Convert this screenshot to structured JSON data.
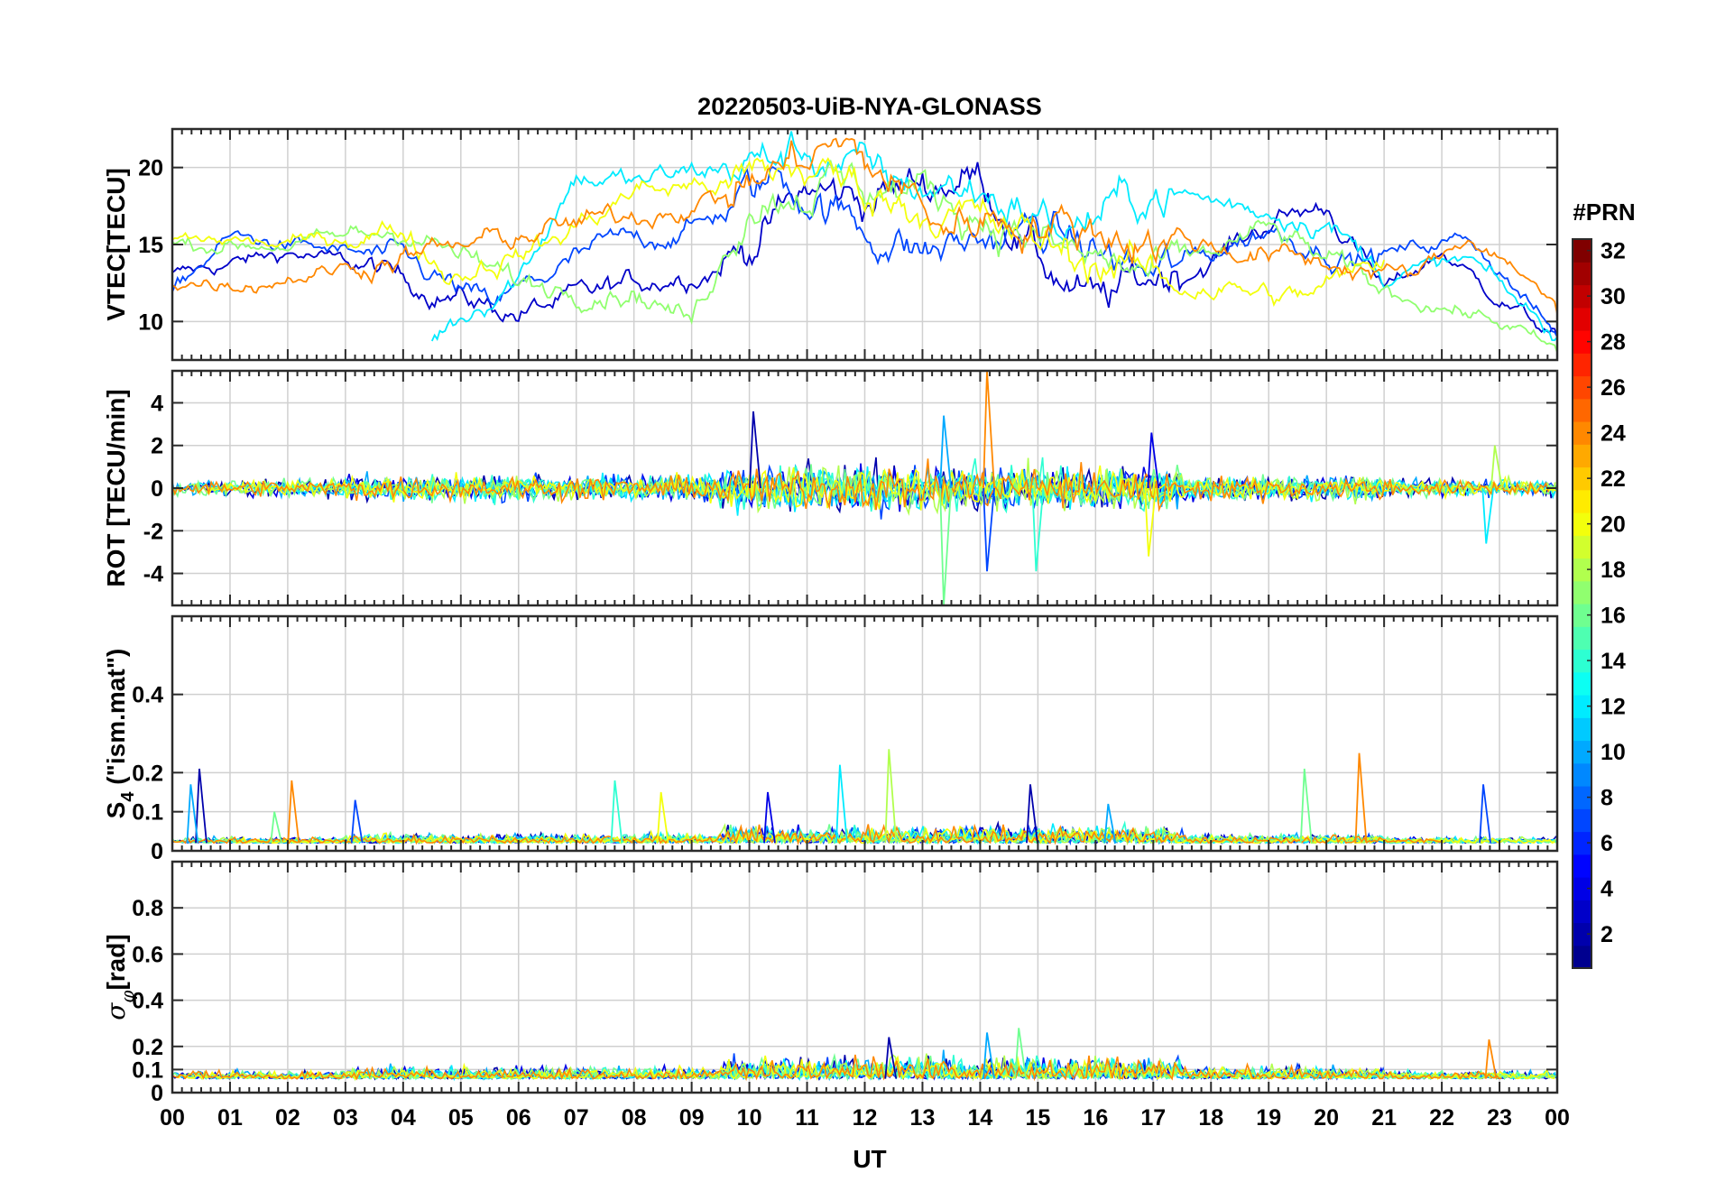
{
  "title": "20220503-UiB-NYA-GLONASS",
  "xlabel": "UT",
  "x_tick_labels": [
    "00",
    "01",
    "02",
    "03",
    "04",
    "05",
    "06",
    "07",
    "08",
    "09",
    "10",
    "11",
    "12",
    "13",
    "14",
    "15",
    "16",
    "17",
    "18",
    "19",
    "20",
    "21",
    "22",
    "23",
    "00"
  ],
  "colorbar": {
    "label": "#PRN",
    "ticks": [
      "2",
      "4",
      "6",
      "8",
      "10",
      "12",
      "14",
      "16",
      "18",
      "20",
      "22",
      "24",
      "26",
      "28",
      "30",
      "32"
    ],
    "range": [
      1,
      32
    ],
    "colormap": "jet",
    "colors": [
      "#00008f",
      "#0000ff",
      "#0080ff",
      "#00ffff",
      "#80ff80",
      "#ffff00",
      "#ff8000",
      "#ff0000",
      "#800000"
    ]
  },
  "chart_data": [
    {
      "type": "line",
      "panel": "VTEC",
      "ylabel": "VTEC[TECU]",
      "xlim": [
        0,
        24
      ],
      "ylim": [
        7.5,
        22.5
      ],
      "y_ticks": [
        "10",
        "15",
        "20"
      ],
      "grid": true,
      "series_profiles": [
        {
          "prn": 3,
          "x": [
            0.0,
            2.0,
            3.5,
            4.5,
            6.0,
            8.0,
            9.5,
            10.0,
            11.0,
            12.0,
            13.0,
            14.0,
            15.0,
            16.0,
            17.0,
            18.0,
            19.0,
            20.0,
            21.0,
            22.0,
            23.0,
            24.0
          ],
          "y": [
            13,
            14.5,
            13.5,
            12,
            10.5,
            12.5,
            13.5,
            15,
            18.5,
            18,
            19,
            19.5,
            14,
            11,
            13,
            14,
            16.5,
            17.5,
            12,
            14.5,
            11.5,
            9
          ]
        },
        {
          "prn": 7,
          "x": [
            0.0,
            1.0,
            2.0,
            4.0,
            5.5,
            7.5,
            9.0,
            10.5,
            12.0,
            13.0,
            15.0,
            17.0,
            19.0,
            20.5,
            22.5,
            24.0
          ],
          "y": [
            12,
            15.5,
            15,
            14,
            11,
            15,
            16,
            19.5,
            16,
            14.5,
            16,
            13,
            16,
            14,
            15.5,
            9
          ]
        },
        {
          "prn": 12,
          "x": [
            4.5,
            6.0,
            7.0,
            8.0,
            9.5,
            11.0,
            12.5,
            14.0,
            15.5,
            17.0,
            18.5,
            20.0,
            21.0,
            22.5,
            24.0
          ],
          "y": [
            9,
            13,
            19.5,
            19,
            20,
            21,
            19,
            18.5,
            16,
            18.5,
            17.5,
            16.5,
            13,
            14,
            9
          ]
        },
        {
          "prn": 17,
          "x": [
            0.0,
            2.0,
            4.0,
            6.0,
            8.0,
            9.0,
            10.0,
            11.5,
            13.0,
            14.0,
            15.5,
            17.0,
            19.0,
            21.0,
            23.0,
            24.0
          ],
          "y": [
            15,
            15,
            16,
            12.5,
            12,
            10,
            18,
            19,
            18.5,
            17,
            14.5,
            13,
            16,
            12,
            10,
            8
          ]
        },
        {
          "prn": 20,
          "x": [
            0.0,
            2.0,
            4.0,
            4.8,
            6.5,
            8.0,
            9.5,
            11.0,
            12.5,
            14.0,
            15.5,
            17.5,
            19.5,
            21.0
          ],
          "y": [
            15.5,
            15,
            16,
            13,
            15,
            18.5,
            19,
            20,
            18,
            16.5,
            14.5,
            12.5,
            11.5,
            14
          ]
        },
        {
          "prn": 24,
          "x": [
            0.0,
            1.5,
            9.5,
            10.5,
            11.5,
            12.5,
            13.5,
            14.0,
            21.5,
            22.5,
            23.5,
            24.0
          ],
          "y": [
            12.5,
            12.5,
            18,
            20,
            21.5,
            19,
            16,
            17,
            13,
            15.5,
            13,
            10.5
          ]
        }
      ]
    },
    {
      "type": "line",
      "panel": "ROT",
      "ylabel": "ROT [TECU/min]",
      "xlim": [
        0,
        24
      ],
      "ylim": [
        -5.5,
        5.5
      ],
      "y_ticks": [
        "4",
        "2",
        "0",
        "-2",
        "-4"
      ],
      "grid": true,
      "notable_spikes": [
        {
          "x": 10.1,
          "y": 3.6
        },
        {
          "x": 13.4,
          "y": 3.4
        },
        {
          "x": 13.4,
          "y": -5.5
        },
        {
          "x": 14.15,
          "y": 5.5
        },
        {
          "x": 14.15,
          "y": -3.9
        },
        {
          "x": 15.0,
          "y": -3.9
        },
        {
          "x": 16.95,
          "y": -3.2
        },
        {
          "x": 17.0,
          "y": 2.6
        },
        {
          "x": 22.8,
          "y": -2.6
        },
        {
          "x": 22.95,
          "y": 2.0
        }
      ]
    },
    {
      "type": "line",
      "panel": "S4",
      "ylabel": "S4 (\"ism.mat\")",
      "xlim": [
        0,
        24
      ],
      "ylim": [
        0,
        0.6
      ],
      "y_ticks": [
        "0",
        "0.1",
        "0.2",
        "0.4"
      ],
      "grid": true,
      "notable_spikes": [
        {
          "x": 0.5,
          "y": 0.21
        },
        {
          "x": 0.35,
          "y": 0.17
        },
        {
          "x": 1.8,
          "y": 0.1
        },
        {
          "x": 2.1,
          "y": 0.18
        },
        {
          "x": 3.2,
          "y": 0.13
        },
        {
          "x": 7.7,
          "y": 0.18
        },
        {
          "x": 8.5,
          "y": 0.15
        },
        {
          "x": 10.35,
          "y": 0.15
        },
        {
          "x": 11.6,
          "y": 0.22
        },
        {
          "x": 12.45,
          "y": 0.26
        },
        {
          "x": 14.9,
          "y": 0.17
        },
        {
          "x": 16.25,
          "y": 0.12
        },
        {
          "x": 19.65,
          "y": 0.21
        },
        {
          "x": 20.6,
          "y": 0.25
        },
        {
          "x": 22.75,
          "y": 0.17
        }
      ]
    },
    {
      "type": "line",
      "panel": "SigmaPhi",
      "ylabel": "σφ[rad]",
      "xlim": [
        0,
        24
      ],
      "ylim": [
        0,
        1.0
      ],
      "y_ticks": [
        "0",
        "0.1",
        "0.2",
        "0.4",
        "0.6",
        "0.8"
      ],
      "grid": true,
      "notable_spikes": [
        {
          "x": 12.45,
          "y": 0.24
        },
        {
          "x": 14.15,
          "y": 0.26
        },
        {
          "x": 14.7,
          "y": 0.28
        },
        {
          "x": 22.85,
          "y": 0.23
        }
      ]
    }
  ]
}
